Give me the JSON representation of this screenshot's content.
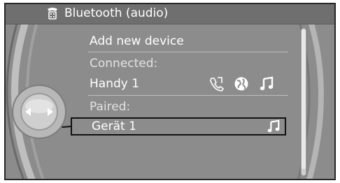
{
  "header": {
    "icon": "bluetooth-phone-icon",
    "title": "Bluetooth (audio)"
  },
  "menu": {
    "add_new_device": "Add new device",
    "connected_label": "Connected:",
    "connected_device": "Handy 1",
    "connected_icons": [
      "phone-book-icon",
      "globe-icon",
      "music-note-icon"
    ],
    "paired_label": "Paired:",
    "paired_device": "Gerät 1",
    "paired_icons": [
      "music-note-icon"
    ]
  },
  "controller": {
    "icon": "idrive-controller-icon"
  },
  "colors": {
    "screen_bg": "#8c8c8c",
    "header_bg": "#6f6f6f",
    "text": "#ffffff",
    "selection_border": "#111111"
  }
}
